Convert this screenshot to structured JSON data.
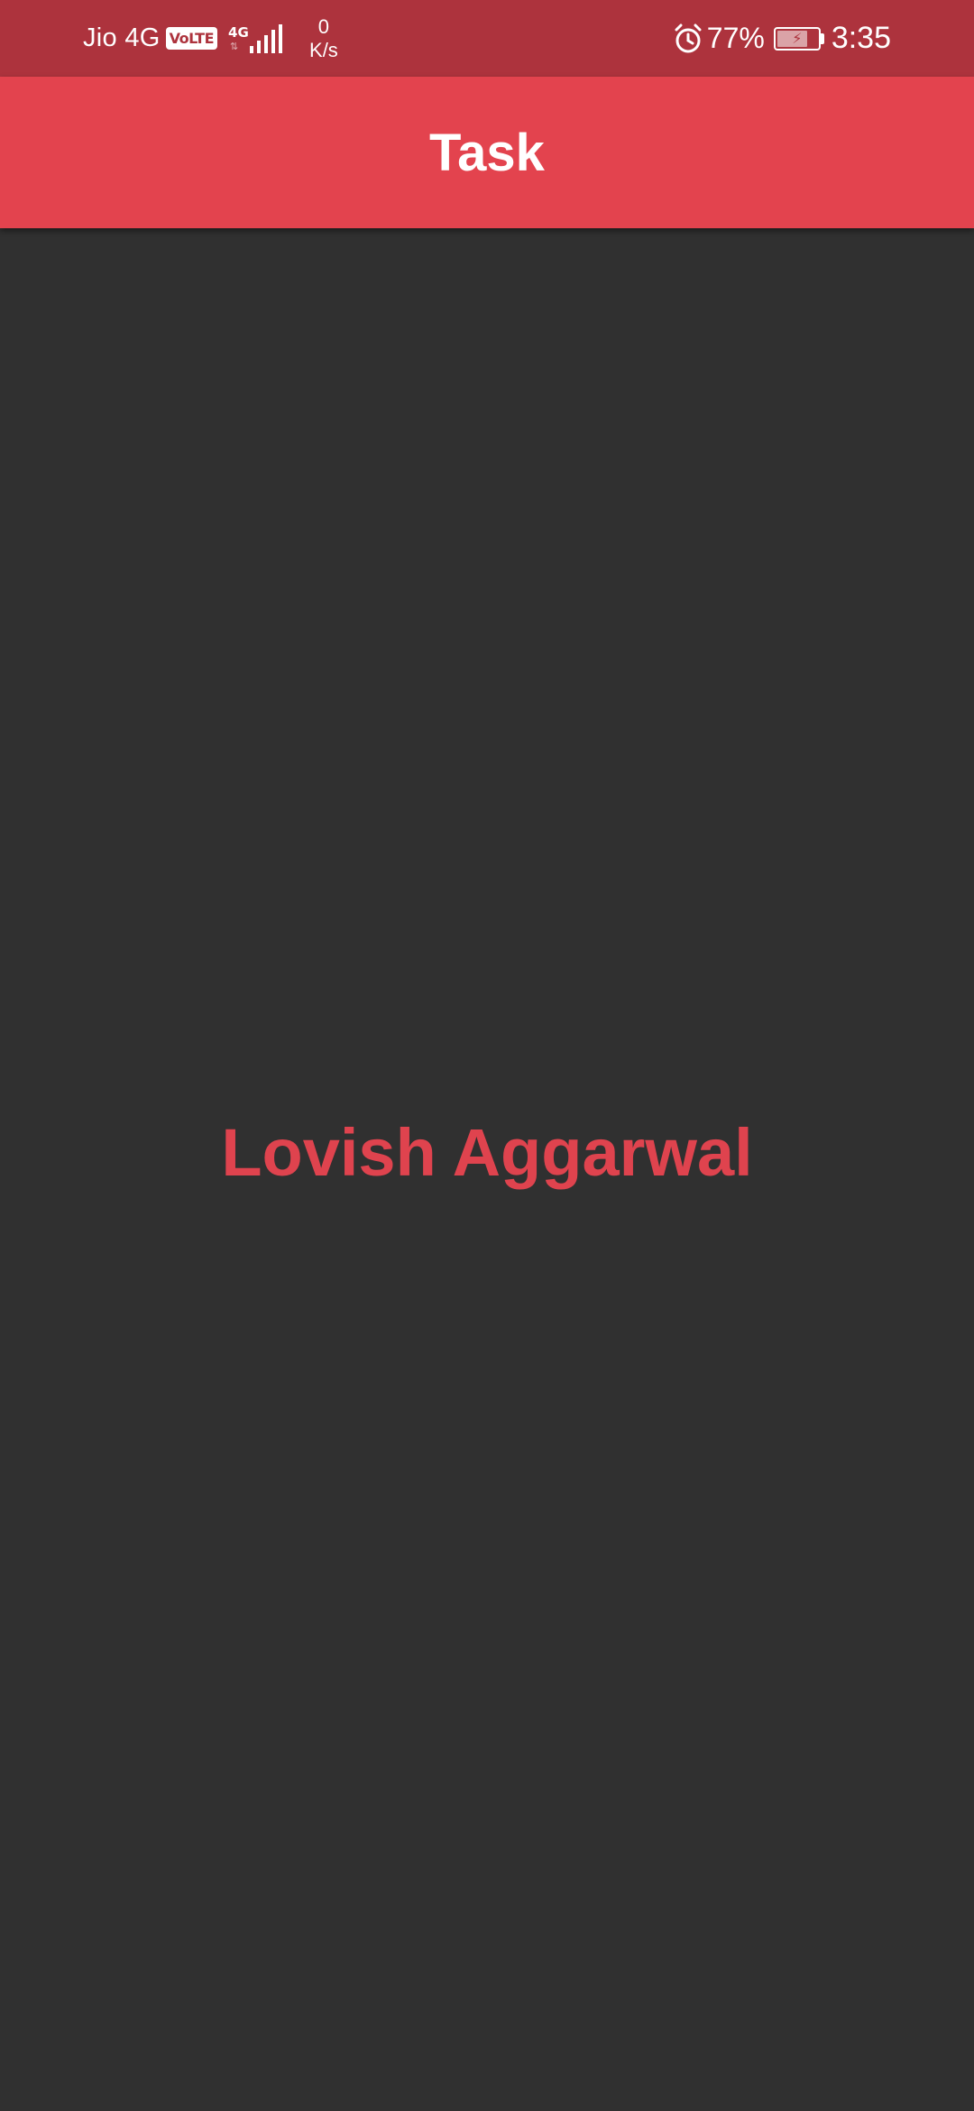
{
  "status_bar": {
    "carrier": "Jio 4G",
    "volte_badge": "VoLTE",
    "network_type": "4G",
    "speed_value": "0",
    "speed_unit": "K/s",
    "battery_percent": "77%",
    "battery_level": 0.77,
    "charging": true,
    "time": "3:35",
    "icons": [
      "volte-icon",
      "signal-icon",
      "alarm-icon",
      "battery-icon"
    ]
  },
  "app_bar": {
    "title": "Task"
  },
  "main": {
    "center_text": "Lovish Aggarwal"
  },
  "colors": {
    "status_bar": "#ad333d",
    "app_bar": "#e3434e",
    "background": "#303030",
    "accent_text": "#df434e"
  }
}
